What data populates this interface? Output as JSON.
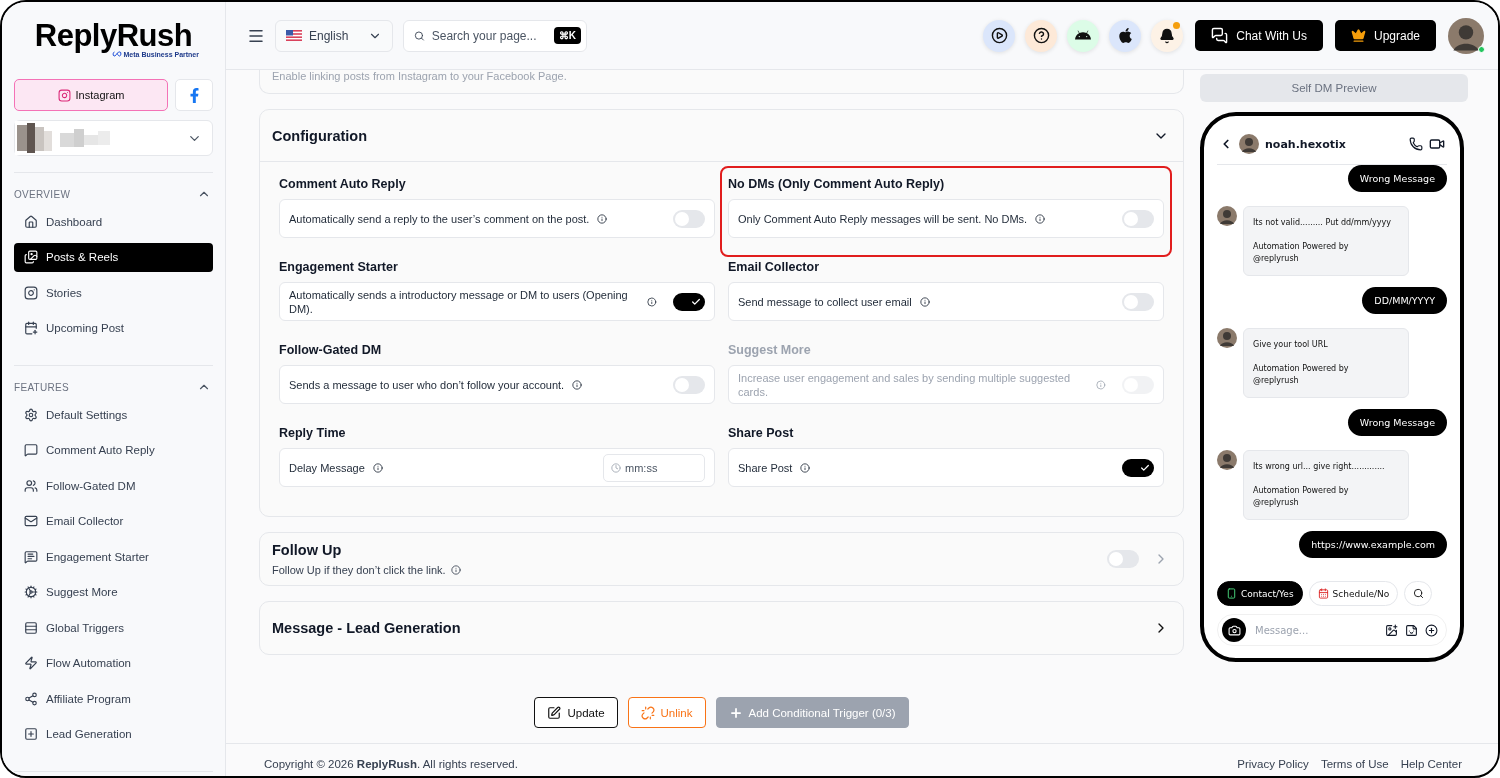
{
  "brand": {
    "name": "ReplyRush",
    "partner": "Meta Business Partner"
  },
  "platforms": [
    {
      "label": "Instagram",
      "selected": true
    },
    {
      "selected": false
    }
  ],
  "sidebar": {
    "sections": [
      {
        "title": "OVERVIEW",
        "expanded": true,
        "items": [
          {
            "label": "Dashboard",
            "selected": false
          },
          {
            "label": "Posts & Reels",
            "selected": true
          },
          {
            "label": "Stories",
            "selected": false
          },
          {
            "label": "Upcoming Post",
            "selected": false
          }
        ]
      },
      {
        "title": "FEATURES",
        "expanded": true,
        "items": [
          {
            "label": "Default Settings",
            "selected": false
          },
          {
            "label": "Comment Auto Reply",
            "selected": false
          },
          {
            "label": "Follow-Gated DM",
            "selected": false
          },
          {
            "label": "Email Collector",
            "selected": false
          },
          {
            "label": "Engagement Starter",
            "selected": false
          },
          {
            "label": "Suggest More",
            "selected": false
          },
          {
            "label": "Global Triggers",
            "selected": false
          },
          {
            "label": "Flow Automation",
            "selected": false
          },
          {
            "label": "Affiliate Program",
            "selected": false
          },
          {
            "label": "Lead Generation",
            "selected": false
          }
        ]
      }
    ]
  },
  "header": {
    "language": "English",
    "search": {
      "placeholder": "Search your page...",
      "shortcut": "⌘K"
    },
    "notification_dot": true,
    "chat_button": "Chat With Us",
    "upgrade_button": "Upgrade",
    "online": true
  },
  "top_card": {
    "text": "Enable linking posts from Instagram to your Facebook Page."
  },
  "sections": [
    {
      "title": "Configuration",
      "expanded": true,
      "settings": [
        {
          "title": "Comment Auto Reply",
          "description": "Automatically send a reply to the user’s comment on the post.",
          "kind": "toggle",
          "on": false,
          "disabled": false,
          "highlighted": false
        },
        {
          "title": "No DMs (Only Comment Auto Reply)",
          "description": "Only Comment Auto Reply messages will be sent. No DMs.",
          "kind": "toggle",
          "on": false,
          "disabled": false,
          "highlighted": true
        },
        {
          "title": "Engagement Starter",
          "description": "Automatically sends a introductory message or DM to users (Opening DM).",
          "kind": "toggle",
          "on": true,
          "disabled": false,
          "highlighted": false
        },
        {
          "title": "Email Collector",
          "description": "Send message to collect user email",
          "kind": "toggle",
          "on": false,
          "disabled": false,
          "highlighted": false
        },
        {
          "title": "Follow-Gated DM",
          "description": "Sends a message to user who don’t follow your account.",
          "kind": "toggle",
          "on": false,
          "disabled": false,
          "highlighted": false
        },
        {
          "title": "Suggest More",
          "description": "Increase user engagement and sales by sending multiple suggested cards.",
          "kind": "toggle",
          "on": false,
          "disabled": true,
          "highlighted": false
        },
        {
          "title": "Reply Time",
          "description": "Delay Message",
          "kind": "time",
          "placeholder": "mm:ss",
          "disabled": false,
          "highlighted": false
        },
        {
          "title": "Share Post",
          "description": "Share Post",
          "kind": "toggle",
          "on": true,
          "disabled": false,
          "highlighted": false
        }
      ]
    },
    {
      "title": "Follow Up",
      "description": "Follow Up if they don’t click the link.",
      "expanded": false,
      "toggle": {
        "on": false
      }
    },
    {
      "title": "Message - Lead Generation",
      "expanded": false
    }
  ],
  "actions": [
    {
      "label": "Update",
      "kind": "outline"
    },
    {
      "label": "Unlink",
      "kind": "danger"
    },
    {
      "label": "Add Conditional Trigger (0/3)",
      "kind": "disabled"
    }
  ],
  "preview": {
    "title": "Self DM Preview",
    "contact": "noah.hexotix",
    "messages": [
      {
        "kind": "sent",
        "text": "Wrong Message"
      },
      {
        "kind": "received",
        "text": "Its not valid......... Put dd/mm/yyyy\n\nAutomation Powered by\n@replyrush"
      },
      {
        "kind": "sent",
        "text": "DD/MM/YYYY"
      },
      {
        "kind": "received",
        "text": "Give your tool URL\n\nAutomation Powered by\n@replyrush"
      },
      {
        "kind": "sent",
        "text": "Wrong Message"
      },
      {
        "kind": "received",
        "text": "Its wrong url... give right.............\n\nAutomation Powered by\n@replyrush"
      },
      {
        "kind": "sent",
        "text": "https://www.example.com"
      }
    ],
    "quick_replies": [
      {
        "label": "Contact/Yes",
        "selected": true
      },
      {
        "label": "Schedule/No",
        "selected": false
      }
    ],
    "composer": {
      "placeholder": "Message..."
    }
  },
  "footer": {
    "copyright": "Copyright © 2026 **ReplyRush**. All rights reserved.",
    "links": [
      "Privacy Policy",
      "Terms of Use",
      "Help Center"
    ]
  }
}
